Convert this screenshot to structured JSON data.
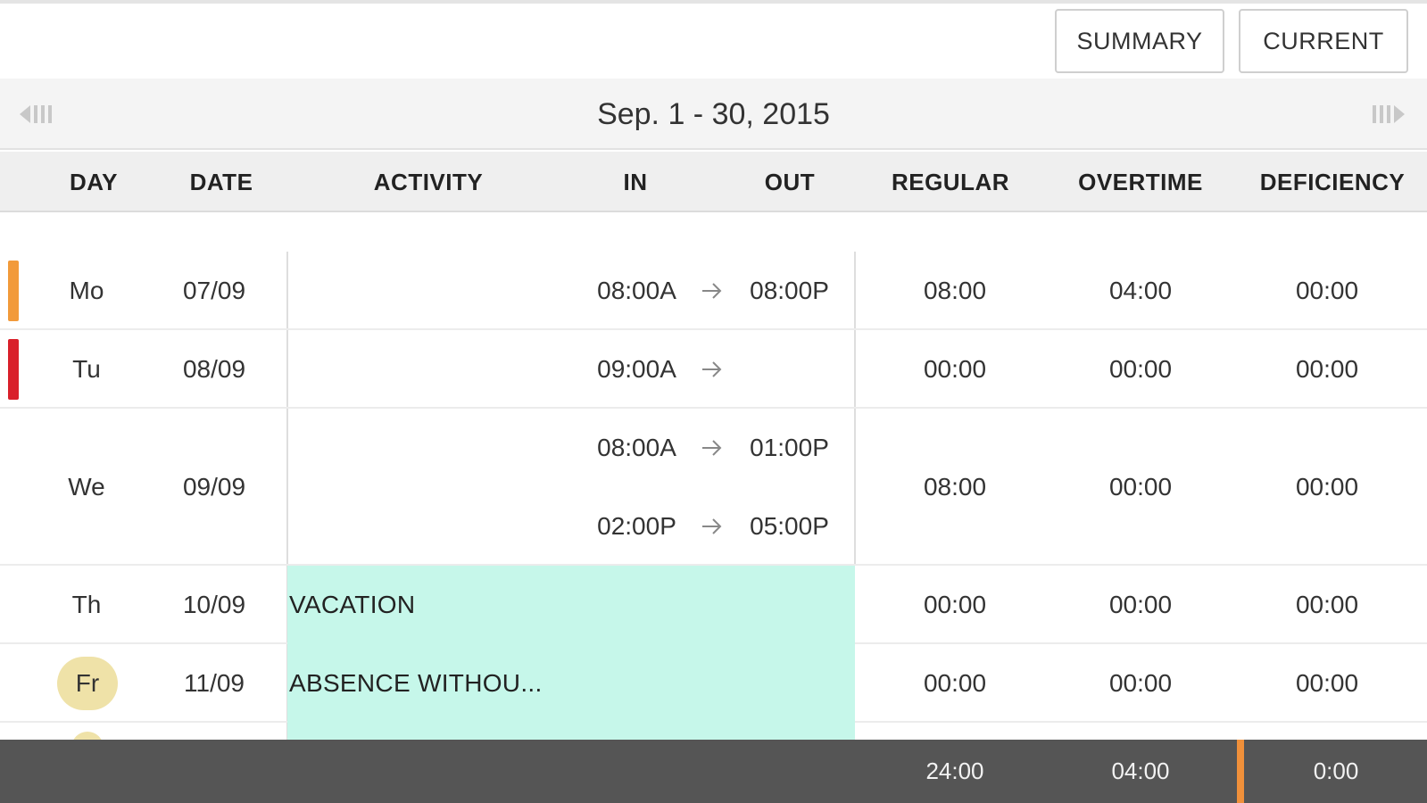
{
  "toolbar": {
    "summary_label": "SUMMARY",
    "current_label": "CURRENT"
  },
  "period": {
    "label": "Sep. 1 - 30, 2015",
    "prev_icon": "prev-period-icon",
    "next_icon": "next-period-icon"
  },
  "columns": {
    "day": "DAY",
    "date": "DATE",
    "activity": "ACTIVITY",
    "in": "IN",
    "out": "OUT",
    "regular": "REGULAR",
    "overtime": "OVERTIME",
    "deficiency": "DEFICIENCY"
  },
  "rows": [
    {
      "day": "Mo",
      "date": "07/09",
      "flag_color": "#f29a3a",
      "punches": [
        {
          "in": "08:00A",
          "out": "08:00P"
        }
      ],
      "regular": "08:00",
      "overtime": "04:00",
      "deficiency": "00:00"
    },
    {
      "day": "Tu",
      "date": "08/09",
      "flag_color": "#d9202a",
      "punches": [
        {
          "in": "09:00A",
          "out": ""
        }
      ],
      "regular": "00:00",
      "overtime": "00:00",
      "deficiency": "00:00"
    },
    {
      "day": "We",
      "date": "09/09",
      "punches": [
        {
          "in": "08:00A",
          "out": "01:00P"
        },
        {
          "in": "02:00P",
          "out": "05:00P"
        }
      ],
      "regular": "08:00",
      "overtime": "00:00",
      "deficiency": "00:00"
    },
    {
      "day": "Th",
      "date": "10/09",
      "activity": "VACATION",
      "regular": "00:00",
      "overtime": "00:00",
      "deficiency": "00:00"
    },
    {
      "day": "Fr",
      "date": "11/09",
      "activity": "ABSENCE WITHOU...",
      "is_today": true,
      "regular": "00:00",
      "overtime": "00:00",
      "deficiency": "00:00"
    }
  ],
  "totals": {
    "regular": "24:00",
    "overtime": "04:00",
    "deficiency": "0:00"
  },
  "colors": {
    "activity_bg": "#c6f7ea",
    "today_badge": "#efe2a8",
    "footer_bg": "#555555",
    "footer_divider": "#f0903a"
  }
}
